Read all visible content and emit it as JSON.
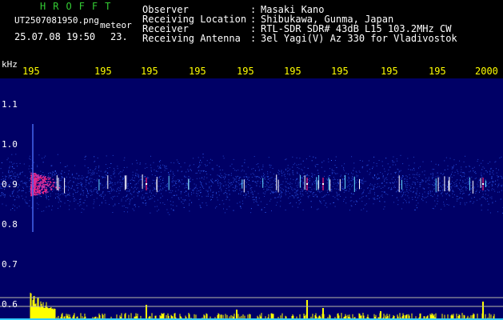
{
  "header": {
    "brand": "HROFFT",
    "filename": "UT2507081950.png",
    "mode": "meteor",
    "datetime": "25.07.08 19:50",
    "count": "23.",
    "fields": [
      {
        "label": "Observer",
        "value": "Masaki Kano"
      },
      {
        "label": "Receiving Location",
        "value": "Shibukawa, Gunma, Japan"
      },
      {
        "label": "Receiver",
        "value": "RTL-SDR SDR# 43dB L15 103.2MHz CW"
      },
      {
        "label": "Receiving Antenna",
        "value": "3el Yagi(V) Az 330 for Vladivostok"
      }
    ]
  },
  "chart_data": {
    "type": "heatmap",
    "ylabel": "kHz",
    "y_ticks": [
      "1.1",
      "1.0",
      "0.9",
      "0.8",
      "0.7",
      "0.6"
    ],
    "x_ticks": [
      "195",
      "195",
      "195",
      "195",
      "195",
      "195",
      "195",
      "195",
      "195",
      "2000"
    ],
    "ylim": [
      0.6,
      1.15
    ],
    "colors": {
      "background": "#000066",
      "noise": "#2244cc",
      "signal": "#ff2277",
      "strong": "#ffffff",
      "level_bars": "#ffff00",
      "baseline": "#33ccff",
      "tick_labels": "#ffff00",
      "axis_labels": "#ffffff"
    }
  }
}
